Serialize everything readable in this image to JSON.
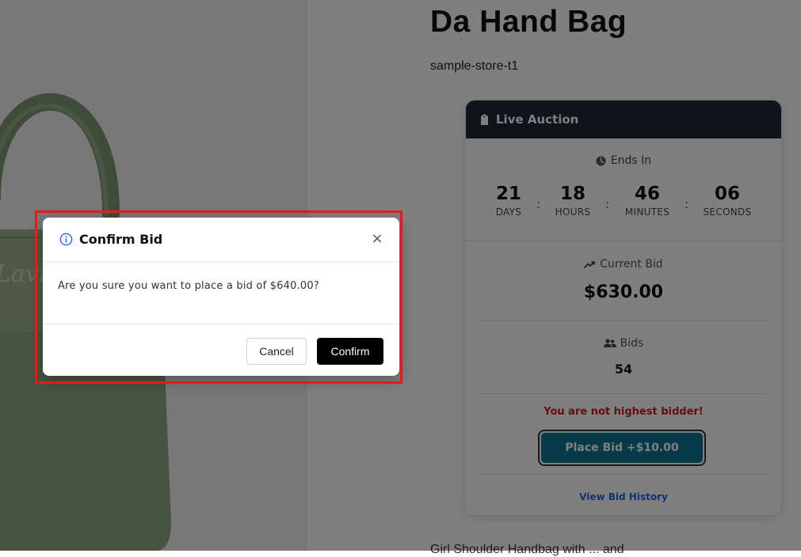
{
  "product": {
    "title": "Da Hand Bag",
    "store": "sample-store-t1",
    "description_peek": "Girl Shoulder Handbag with ... and"
  },
  "auction": {
    "header_label": "Live Auction",
    "header_icon": "tag-icon",
    "ends_in_label": "Ends In",
    "ends_in_icon": "clock-icon",
    "countdown": [
      {
        "value": "21",
        "label": "DAYS"
      },
      {
        "value": "18",
        "label": "HOURS"
      },
      {
        "value": "46",
        "label": "MINUTES"
      },
      {
        "value": "06",
        "label": "SECONDS"
      }
    ],
    "separator": ":",
    "current_bid_label": "Current Bid",
    "current_bid_icon": "trending-up-icon",
    "current_bid_value": "$630.00",
    "bids_label": "Bids",
    "bids_icon": "users-icon",
    "bids_value": "54",
    "status_message": "You are not highest bidder!",
    "place_bid_label": "Place Bid +$10.00",
    "view_history_label": "View Bid History"
  },
  "modal": {
    "icon": "info-icon",
    "title": "Confirm Bid",
    "close_label": "×",
    "message": "Are you sure you want to place a bid of $640.00?",
    "cancel_label": "Cancel",
    "confirm_label": "Confirm"
  },
  "colors": {
    "auction_header_bg": "#1f2937",
    "place_bid_bg": "#0e7490",
    "status_red": "#c81e1e",
    "link_blue": "#2563eb",
    "highlight_red": "#e31b1b",
    "bag_green": "#8fa882"
  }
}
